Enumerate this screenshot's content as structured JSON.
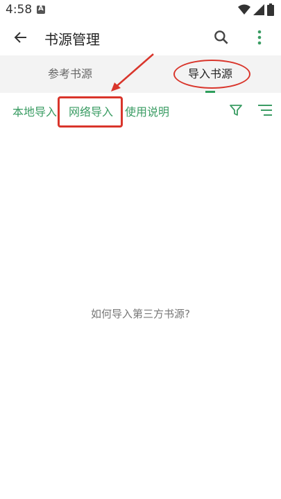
{
  "status_bar": {
    "time": "4:58",
    "icons": [
      "notification-a-icon",
      "wifi-icon",
      "signal-icon",
      "battery-icon"
    ]
  },
  "app_bar": {
    "title": "书源管理",
    "icons": [
      "back-arrow-icon",
      "search-icon",
      "more-vertical-icon"
    ]
  },
  "tabs": [
    {
      "label": "参考书源",
      "selected": false
    },
    {
      "label": "导入书源",
      "selected": true
    }
  ],
  "actions": {
    "local_import": "本地导入",
    "network_import": "网络导入",
    "instructions": "使用说明",
    "icons": [
      "filter-icon",
      "sort-menu-icon"
    ]
  },
  "empty_state": {
    "link": "如何导入第三方书源?"
  },
  "colors": {
    "accent_green": "#3a9c63",
    "annotation_red": "#d9352b",
    "tab_background": "#f3f3f3"
  }
}
